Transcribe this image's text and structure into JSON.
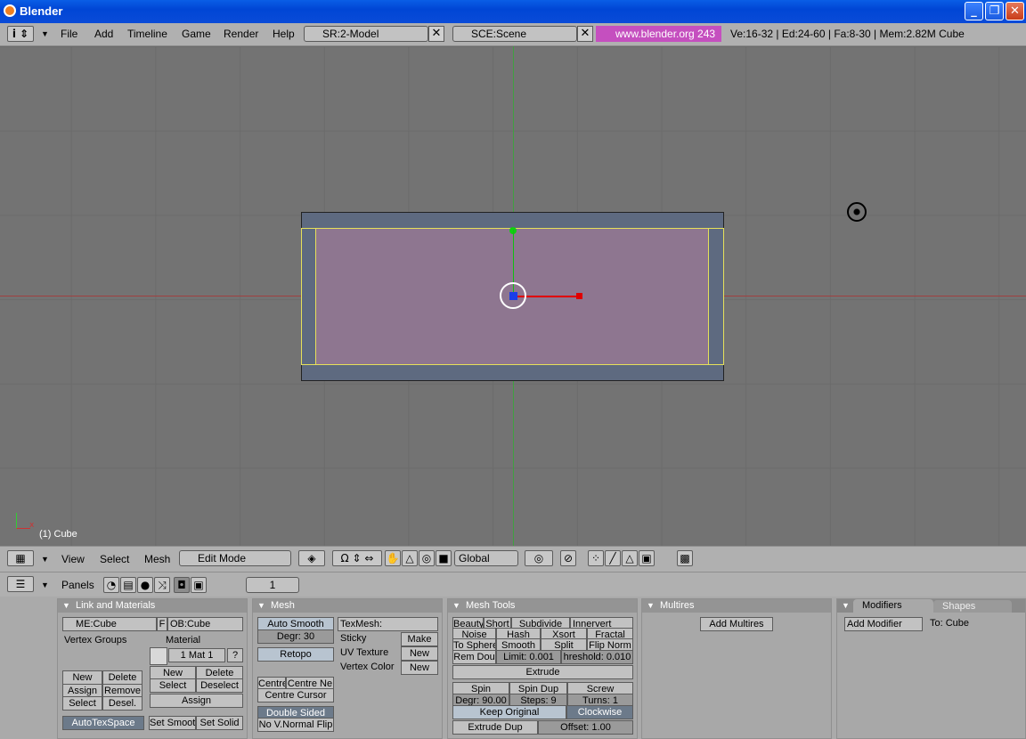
{
  "window": {
    "title": "Blender"
  },
  "menu": {
    "items": [
      "File",
      "Add",
      "Timeline",
      "Game",
      "Render",
      "Help"
    ],
    "screen": "SR:2-Model",
    "scene": "SCE:Scene",
    "url": "www.blender.org 243",
    "stats": "Ve:16-32 | Ed:24-60 | Fa:8-30 | Mem:2.82M Cube"
  },
  "viewport": {
    "object_label": "(1) Cube",
    "axis_x": "x"
  },
  "header3d": {
    "view": "View",
    "select": "Select",
    "mesh": "Mesh",
    "mode": "Edit Mode",
    "orientation": "Global"
  },
  "buttons_header": {
    "panels": "Panels",
    "frame": "1"
  },
  "link": {
    "title": "Link and Materials",
    "me": "ME:Cube",
    "f": "F",
    "ob": "OB:Cube",
    "vertex_groups": "Vertex Groups",
    "material": "Material",
    "mat": "1 Mat 1",
    "q": "?",
    "new": "New",
    "delete": "Delete",
    "assign": "Assign",
    "remove": "Remove",
    "select": "Select",
    "desel": "Desel.",
    "new2": "New",
    "delete2": "Delete",
    "select2": "Select",
    "deselect2": "Deselect",
    "assign2": "Assign",
    "autotex": "AutoTexSpace",
    "set_smooth": "Set Smoot",
    "set_solid": "Set Solid"
  },
  "mesh": {
    "title": "Mesh",
    "auto_smooth": "Auto Smooth",
    "degr": "Degr: 30",
    "retopo": "Retopo",
    "texmesh": "TexMesh:",
    "sticky": "Sticky",
    "make": "Make",
    "uv": "UV Texture",
    "new1": "New",
    "vcol": "Vertex Color",
    "new2": "New",
    "centre": "Centre",
    "centre_new": "Centre Ne",
    "centre_cursor": "Centre Cursor",
    "double_sided": "Double Sided",
    "no_vnormal": "No V.Normal Flip"
  },
  "tools": {
    "title": "Mesh Tools",
    "beauty": "Beauty",
    "short": "Short",
    "subdivide": "Subdivide",
    "innervert": "Innervert",
    "noise": "Noise",
    "hash": "Hash",
    "xsort": "Xsort",
    "fractal": "Fractal",
    "to_sphere": "To Sphere",
    "smooth": "Smooth",
    "split": "Split",
    "flip_norm": "Flip Norm",
    "rem_dou": "Rem Dou",
    "limit": "Limit: 0.001",
    "threshold": "hreshold: 0.010",
    "extrude": "Extrude",
    "spin": "Spin",
    "spin_dup": "Spin Dup",
    "screw": "Screw",
    "degr": "Degr: 90.00",
    "steps": "Steps: 9",
    "turns": "Turns: 1",
    "keep_original": "Keep Original",
    "clockwise": "Clockwise",
    "extrude_dup": "Extrude Dup",
    "offset": "Offset: 1.00"
  },
  "multires": {
    "title": "Multires",
    "add": "Add Multires"
  },
  "modifiers": {
    "tab1": "Modifiers",
    "tab2": "Shapes",
    "add": "Add Modifier",
    "to": "To: Cube"
  }
}
